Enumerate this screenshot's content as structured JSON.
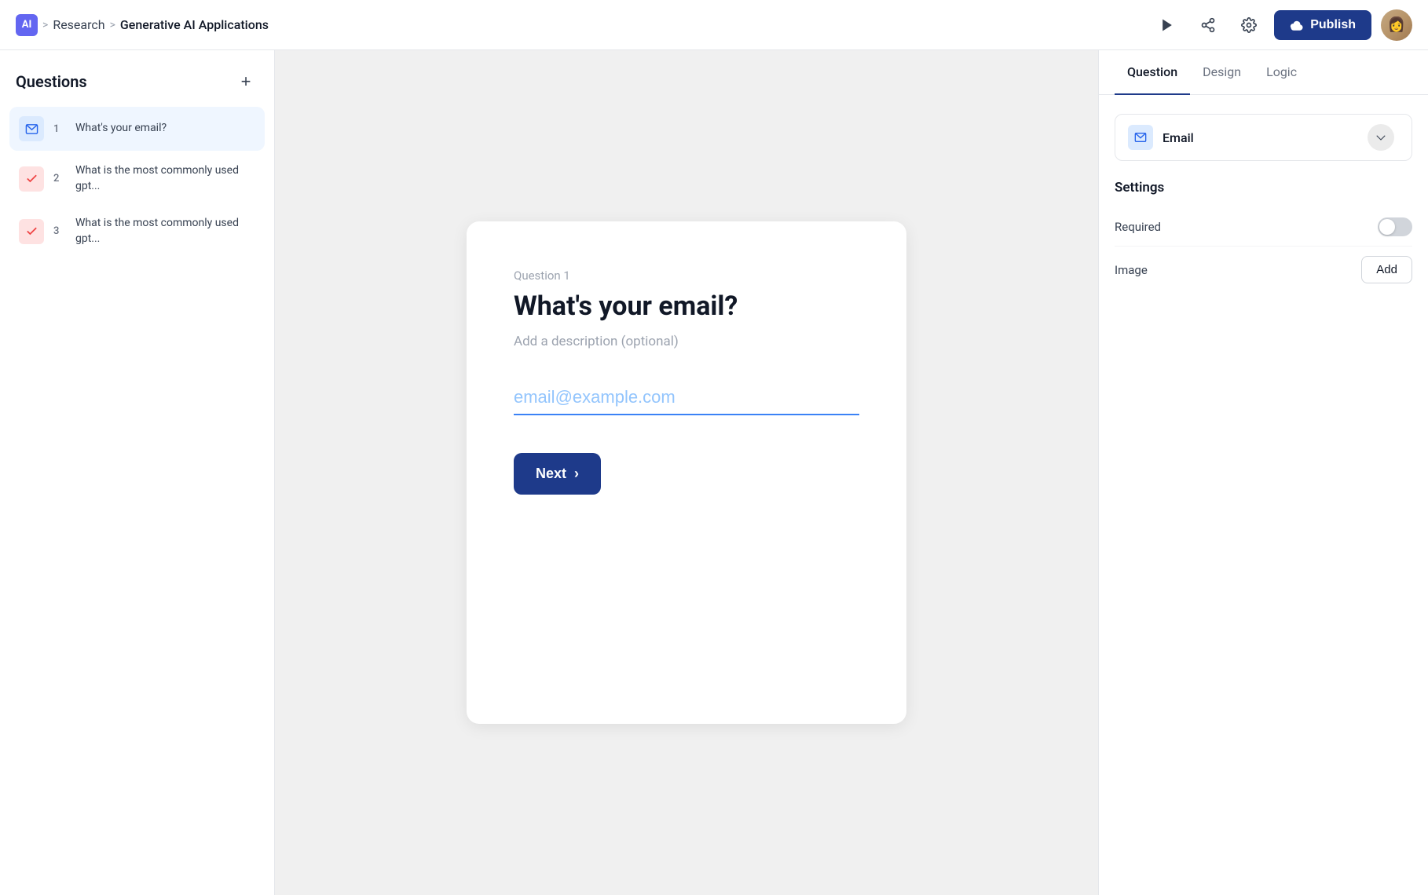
{
  "topbar": {
    "ai_label": "AI",
    "breadcrumb_sep1": ">",
    "breadcrumb_sep2": ">",
    "research_label": "Research",
    "app_label": "Generative AI Applications",
    "publish_label": "Publish"
  },
  "sidebar": {
    "title": "Questions",
    "add_icon": "+",
    "questions": [
      {
        "number": "1",
        "text": "What's your email?",
        "icon_type": "email",
        "active": true
      },
      {
        "number": "2",
        "text": "What is the most commonly used gpt...",
        "icon_type": "check",
        "active": false
      },
      {
        "number": "3",
        "text": "What is the most commonly used gpt...",
        "icon_type": "check",
        "active": false
      }
    ]
  },
  "preview": {
    "question_label": "Question 1",
    "question_title": "What's your email?",
    "description_placeholder": "Add a description (optional)",
    "email_placeholder": "email@example.com",
    "next_label": "Next"
  },
  "right_panel": {
    "tabs": [
      {
        "label": "Question",
        "active": true
      },
      {
        "label": "Design",
        "active": false
      },
      {
        "label": "Logic",
        "active": false
      }
    ],
    "type_label": "Email",
    "settings": {
      "heading": "Settings",
      "required_label": "Required",
      "required_on": false,
      "image_label": "Image",
      "add_image_label": "Add"
    }
  }
}
